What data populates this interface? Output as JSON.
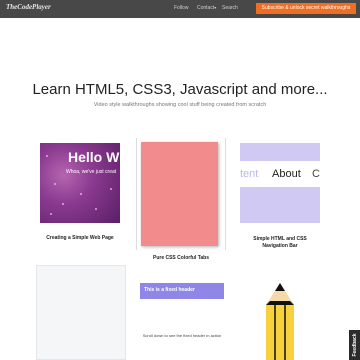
{
  "header": {
    "logo": "TheCodePlayer",
    "nav": [
      "Follow",
      "Contact",
      "Search"
    ],
    "contact_caret": "▾",
    "subscribe_label": "Subscribe & unlock secret walkthroughs"
  },
  "hero": {
    "title": "Learn HTML5, CSS3, Javascript and more...",
    "subtitle": "Video style walkthroughs showing cool stuff being created from scratch"
  },
  "cards": [
    {
      "caption": "Creating a Simple Web Page",
      "thumb_title": "Hello W",
      "thumb_text": "Whoa, we've just creat"
    },
    {
      "caption": "Pure CSS Colorful Tabs",
      "thumb_color": "#f28c8c"
    },
    {
      "caption_line1": "Simple HTML and CSS",
      "caption_line2": "Navigation Bar",
      "nav_words": [
        "tent",
        "About",
        "C"
      ]
    },
    {
      "caption": ""
    },
    {
      "header_text": "This is a fixed header",
      "scroll_text": "Scroll down to see the fixed header in action"
    },
    {
      "caption": "",
      "icon": "pencil-icon"
    }
  ],
  "feedback_label": "Feedback",
  "colors": {
    "topbar": "#484848",
    "subscribe": "#f06d22",
    "pink": "#f28c8c",
    "lavender": "#cfc9f3",
    "purple": "#8f86e8"
  }
}
